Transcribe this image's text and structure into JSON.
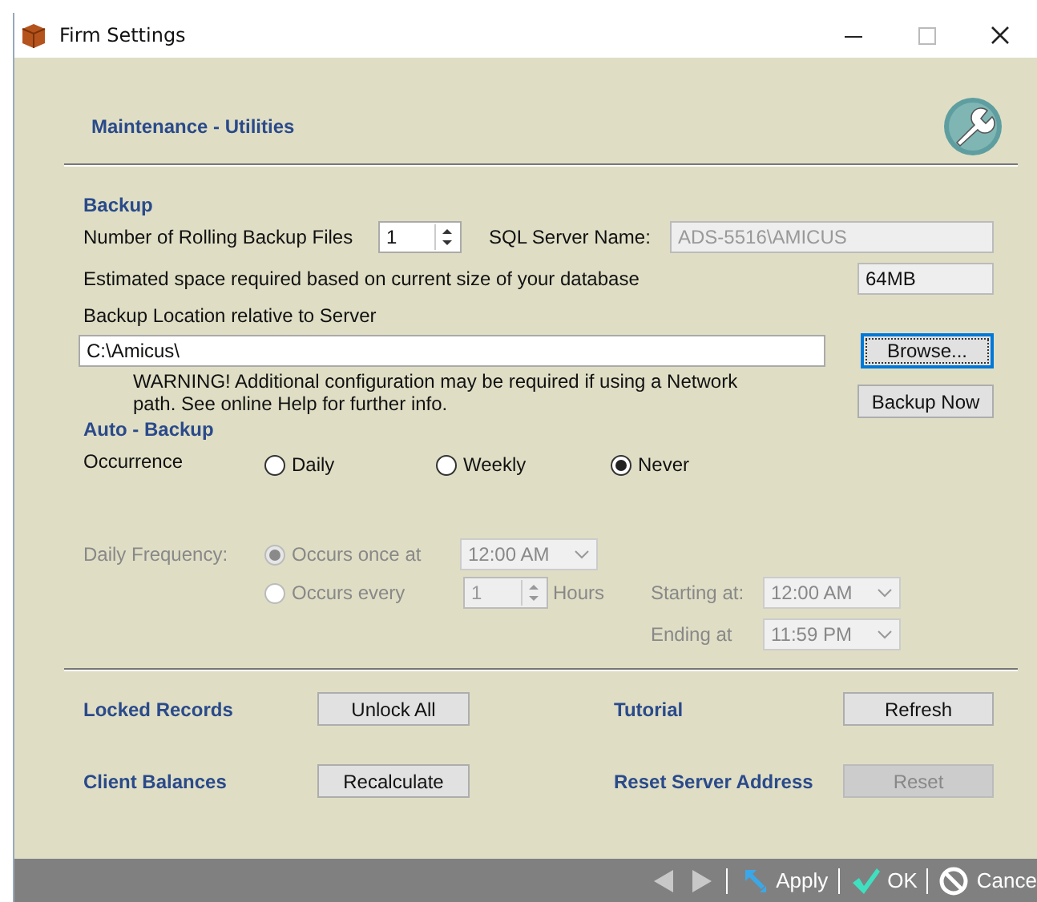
{
  "window": {
    "title": "Firm Settings"
  },
  "header": {
    "title": "Maintenance - Utilities"
  },
  "backup": {
    "heading": "Backup",
    "rolling_label": "Number of Rolling Backup Files",
    "rolling_value": "1",
    "sql_label": "SQL Server Name:",
    "sql_value": "ADS-5516\\AMICUS",
    "sql_disabled": true,
    "estimate_label": "Estimated space required based on current size of your database",
    "estimate_value": "64MB",
    "location_label": "Backup Location relative to Server",
    "location_value": "C:\\Amicus\\",
    "warning": "WARNING! Additional configuration may be required if using a Network path. See online Help for further info.",
    "browse_button": {
      "label": "Browse...",
      "focused": true
    },
    "backup_now_button": {
      "label": "Backup Now",
      "focused": false
    }
  },
  "auto_backup": {
    "heading": "Auto - Backup",
    "occurrence_label": "Occurrence",
    "occurrences": [
      {
        "label": "Daily",
        "selected": false
      },
      {
        "label": "Weekly",
        "selected": false
      },
      {
        "label": "Never",
        "selected": true
      }
    ],
    "daily_frequency": {
      "label": "Daily Frequency:",
      "disabled": true,
      "options": [
        {
          "label": "Occurs once at",
          "selected": true
        },
        {
          "label": "Occurs every",
          "selected": false
        }
      ],
      "once_time": "12:00 AM",
      "every_value": "1",
      "every_unit": "Hours",
      "starting_label": "Starting at:",
      "starting_time": "12:00 AM",
      "ending_label": "Ending at",
      "ending_time": "11:59 PM"
    }
  },
  "utilities": [
    {
      "label": "Locked Records",
      "button": "Unlock All",
      "disabled": false
    },
    {
      "label": "Tutorial",
      "button": "Refresh",
      "disabled": false
    },
    {
      "label": "Client Balances",
      "button": "Recalculate",
      "disabled": false
    },
    {
      "label": "Reset Server Address",
      "button": "Reset",
      "disabled": true
    }
  ],
  "footer": {
    "actions": [
      {
        "kind": "apply",
        "label": "Apply"
      },
      {
        "kind": "ok",
        "label": "OK"
      },
      {
        "kind": "cancel",
        "label": "Cance"
      }
    ]
  }
}
